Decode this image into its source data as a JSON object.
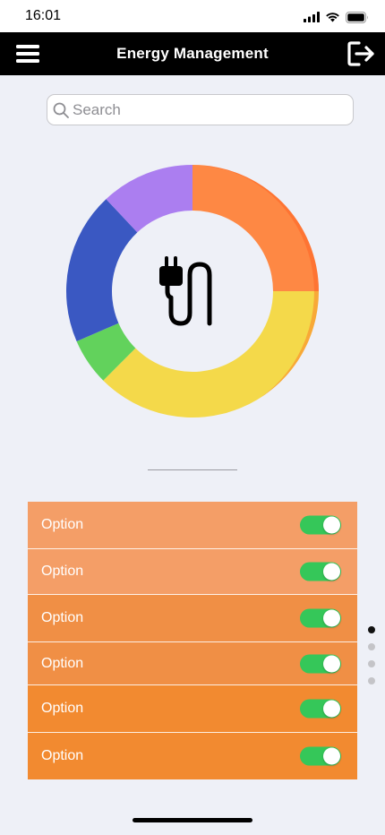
{
  "status_bar": {
    "time": "16:01"
  },
  "nav": {
    "title": "Energy Management"
  },
  "search": {
    "placeholder": "Search",
    "value": ""
  },
  "chart_data": {
    "type": "pie",
    "style": "donut",
    "center_icon": "plug-icon",
    "segments": [
      {
        "color": "#fe8844",
        "value": 25
      },
      {
        "color": "#f4d94a",
        "value": 37.5
      },
      {
        "color": "#62d25c",
        "value": 6
      },
      {
        "color": "#3a58c2",
        "value": 19.5
      },
      {
        "color": "#ab7ef0",
        "value": 12
      }
    ]
  },
  "options": [
    {
      "label": "Option",
      "enabled": true,
      "color": "#f49e67"
    },
    {
      "label": "Option",
      "enabled": true,
      "color": "#f49e67"
    },
    {
      "label": "Option",
      "enabled": true,
      "color": "#f08f45"
    },
    {
      "label": "Option",
      "enabled": true,
      "color": "#f08f45"
    },
    {
      "label": "Option",
      "enabled": true,
      "color": "#f28a30"
    },
    {
      "label": "Option",
      "enabled": true,
      "color": "#f28a30"
    }
  ],
  "pagination": {
    "current": 1,
    "total": 4
  },
  "icons": {
    "menu": "menu-icon",
    "logout": "logout-icon",
    "search": "search-icon",
    "center": "plug-icon"
  },
  "colors": {
    "nav_background": "#000000",
    "page_background": "#eef0f7",
    "toggle_on": "#35c759"
  }
}
